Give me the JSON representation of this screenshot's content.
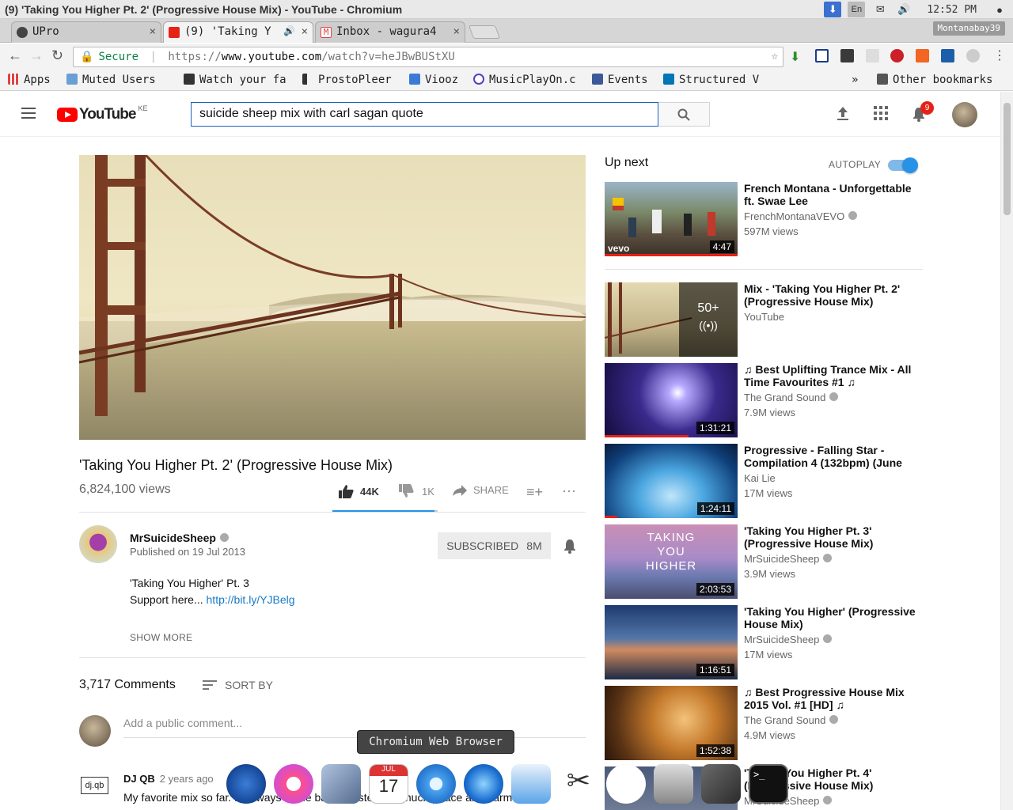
{
  "os": {
    "window_title": "(9) 'Taking You Higher Pt. 2' (Progressive House Mix) - YouTube - Chromium",
    "keyboard": "En",
    "clock": "12:52 PM"
  },
  "tabs": [
    {
      "label": "UPro",
      "close": "×"
    },
    {
      "label": "(9) 'Taking Y",
      "close": "×"
    },
    {
      "label": "Inbox - wagura4",
      "close": "×"
    }
  ],
  "profile_name": "Montanabay39",
  "omnibox": {
    "secure_label": "Secure",
    "url_scheme": "https://",
    "url_host": "www.youtube.com",
    "url_path": "/watch?v=heJBwBUStXU"
  },
  "bookmarks": {
    "items": [
      "Apps",
      "Muted Users",
      "Watch your fa",
      "ProstoPleer",
      "Viooz",
      "MusicPlayOn.c",
      "Events",
      "Structured V"
    ],
    "overflow": "»",
    "other": "Other bookmarks"
  },
  "youtube": {
    "logo_text": "YouTube",
    "country": "KE",
    "search_value": "suicide sheep mix with carl sagan quote",
    "notification_count": "9"
  },
  "video": {
    "title": "'Taking You Higher Pt. 2' (Progressive House Mix)",
    "views": "6,824,100 views",
    "likes": "44K",
    "dislikes": "1K",
    "share": "SHARE",
    "like_ratio": 0.97
  },
  "channel": {
    "name": "MrSuicideSheep",
    "published": "Published on 19 Jul 2013",
    "subscribe_label": "SUBSCRIBED",
    "subscriber_count": "8M"
  },
  "description": {
    "line1": "'Taking You Higher' Pt. 3",
    "line2_prefix": "Support here...",
    "link": "http://bit.ly/YJBelg",
    "show_more": "SHOW MORE"
  },
  "comments": {
    "count": "3,717 Comments",
    "sort_label": "SORT BY",
    "placeholder": "Add a public comment...",
    "first": {
      "avatar_text": "dj.qb",
      "author": "DJ QB",
      "time": "2 years ago",
      "text": "My favorite mix so far. I'll always come back to listen. So much peace and harmony i"
    }
  },
  "sidebar": {
    "up_next": "Up next",
    "autoplay_label": "AUTOPLAY",
    "autoplay_on": true,
    "items": [
      {
        "title": "French Montana - Unforgettable ft. Swae Lee",
        "channel": "FrenchMontanaVEVO",
        "views": "597M views",
        "duration": "4:47",
        "badge": "vevo"
      },
      {
        "title": "Mix - 'Taking You Higher Pt. 2' (Progressive House Mix)",
        "channel": "YouTube",
        "views": "",
        "playlist_count": "50+"
      },
      {
        "title": "♫ Best Uplifting Trance Mix - All Time Favourites #1 ♫",
        "channel": "The Grand Sound",
        "views": "7.9M views",
        "duration": "1:31:21"
      },
      {
        "title": "Progressive - Falling Star - Compilation 4 (132bpm) (June",
        "channel": "Kai Lie",
        "views": "17M views",
        "duration": "1:24:11"
      },
      {
        "title": "'Taking You Higher Pt. 3' (Progressive House Mix)",
        "channel": "MrSuicideSheep",
        "views": "3.9M views",
        "duration": "2:03:53",
        "thumb_text": "TAKING YOU HIGHER"
      },
      {
        "title": "'Taking You Higher' (Progressive House Mix)",
        "channel": "MrSuicideSheep",
        "views": "17M views",
        "duration": "1:16:51"
      },
      {
        "title": "♫ Best Progressive House Mix 2015 Vol. #1 [HD] ♫",
        "channel": "The Grand Sound",
        "views": "4.9M views",
        "duration": "1:52:38"
      },
      {
        "title": "'Taking You Higher Pt. 4' (Progressive House Mix)",
        "channel": "MrSuicideSheep",
        "views": "",
        "duration": ""
      }
    ]
  },
  "dock": {
    "tooltip": "Chromium Web Browser",
    "calendar_month": "JUL",
    "calendar_day": "17"
  }
}
